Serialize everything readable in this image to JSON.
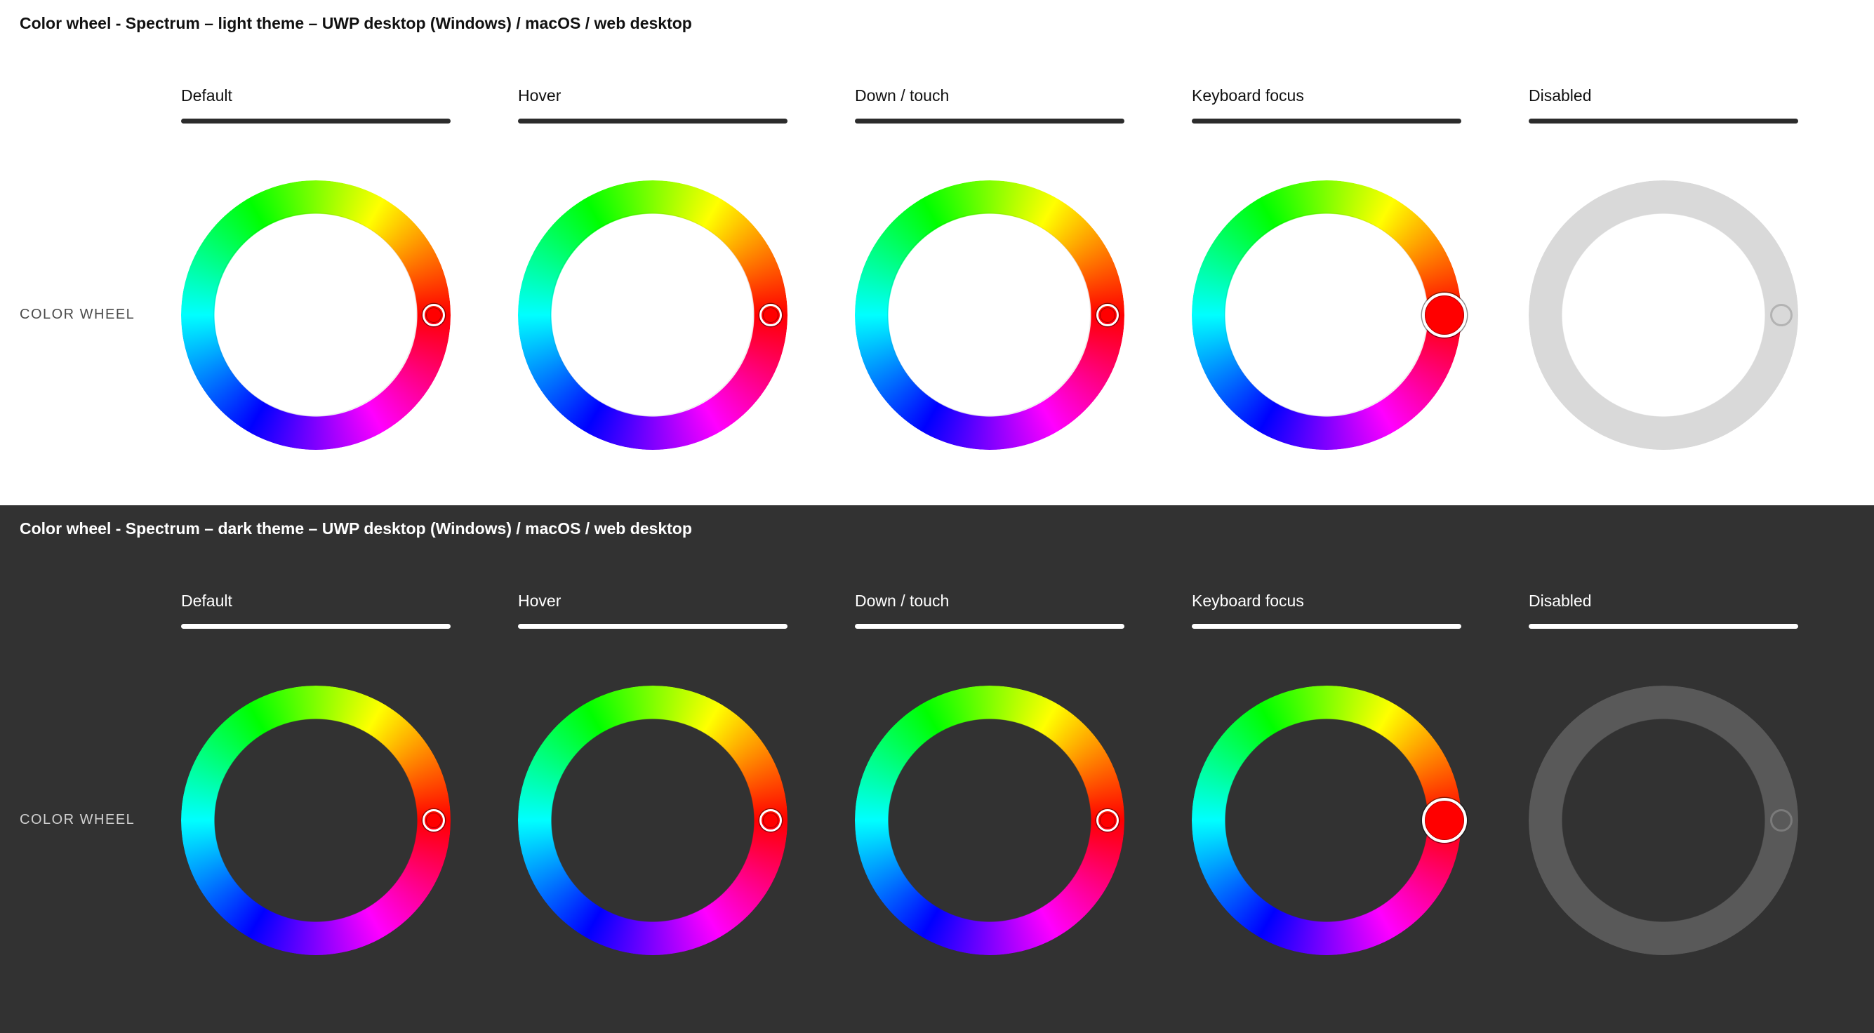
{
  "sections": [
    {
      "id": "light",
      "title": "Color wheel - Spectrum – light theme – UWP desktop (Windows) / macOS / web desktop",
      "row_label": "COLOR WHEEL"
    },
    {
      "id": "dark",
      "title": "Color wheel - Spectrum – dark theme – UWP desktop (Windows) / macOS / web desktop",
      "row_label": "COLOR WHEEL"
    }
  ],
  "states": [
    "Default",
    "Hover",
    "Down / touch",
    "Keyboard focus",
    "Disabled"
  ],
  "colors": {
    "handle_color": "#ff0000",
    "light_bg": "#ffffff",
    "dark_bg": "#323232",
    "disabled_ring_light": "#d9d9d9",
    "disabled_ring_dark": "#595959"
  }
}
